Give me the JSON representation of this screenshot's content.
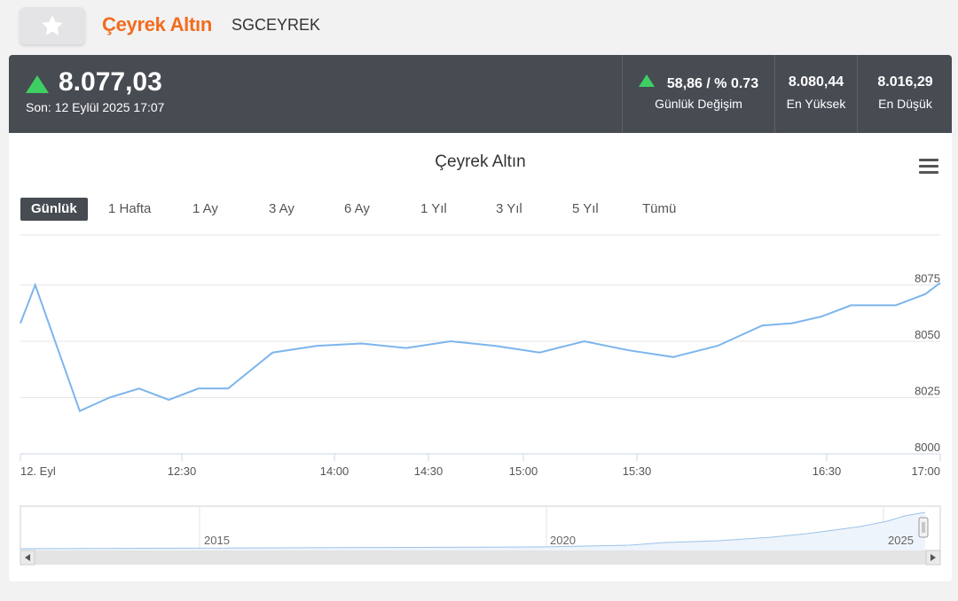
{
  "header": {
    "title": "Çeyrek Altın",
    "code": "SGCEYREK"
  },
  "quote": {
    "price": "8.077,03",
    "updated": "Son: 12 Eylül 2025 17:07",
    "change_value": "58,86 / % 0.73",
    "change_label": "Günlük Değişim",
    "high_value": "8.080,44",
    "high_label": "En Yüksek",
    "low_value": "8.016,29",
    "low_label": "En Düşük",
    "direction": "up",
    "up_color": "#3ecf63"
  },
  "chart": {
    "title": "Çeyrek Altın",
    "ranges": [
      "Günlük",
      "1 Hafta",
      "1 Ay",
      "3 Ay",
      "6 Ay",
      "1 Yıl",
      "3 Yıl",
      "5 Yıl",
      "Tümü"
    ],
    "active_range": "Günlük",
    "menu_icon": "hamburger-icon"
  },
  "chart_data": {
    "type": "line",
    "title": "Çeyrek Altın",
    "series": [
      {
        "color": "#7cb5ec",
        "points": [
          [
            "11:50",
            8058
          ],
          [
            "11:55",
            8075
          ],
          [
            "12:10",
            8019
          ],
          [
            "12:20",
            8025
          ],
          [
            "12:30",
            8029
          ],
          [
            "12:40",
            8024
          ],
          [
            "12:50",
            8029
          ],
          [
            "13:00",
            8029
          ],
          [
            "13:15",
            8045
          ],
          [
            "13:30",
            8048
          ],
          [
            "13:45",
            8049
          ],
          [
            "14:00",
            8047
          ],
          [
            "14:15",
            8050
          ],
          [
            "14:30",
            8048
          ],
          [
            "14:45",
            8045
          ],
          [
            "15:00",
            8050
          ],
          [
            "15:15",
            8046
          ],
          [
            "15:30",
            8043
          ],
          [
            "15:45",
            8048
          ],
          [
            "16:00",
            8057
          ],
          [
            "16:10",
            8058
          ],
          [
            "16:20",
            8061
          ],
          [
            "16:30",
            8066
          ],
          [
            "16:45",
            8066
          ],
          [
            "16:55",
            8071
          ],
          [
            "17:00",
            8076
          ]
        ]
      }
    ],
    "x_ticks": [
      "12. Eyl",
      "12:30",
      "14:00",
      "14:30",
      "15:00",
      "15:30",
      "16:30",
      "17:00"
    ],
    "y_ticks": [
      8000,
      8025,
      8050,
      8075
    ],
    "ylim": [
      8000,
      8100
    ],
    "grid": true,
    "navigator": {
      "labels": [
        "2015",
        "2020",
        "2025"
      ]
    }
  }
}
